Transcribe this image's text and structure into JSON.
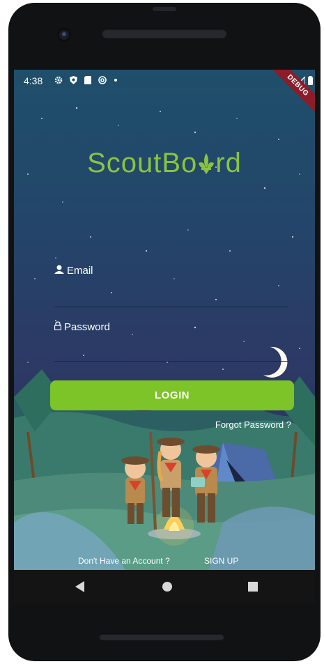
{
  "status_bar": {
    "time": "4:38",
    "left_icons": [
      "gear-icon",
      "shield-icon",
      "sd-card-icon",
      "at-sign-icon",
      "dot-icon"
    ],
    "right_icons": [
      "wifi-icon",
      "signal-icon",
      "battery-icon"
    ],
    "debug_banner": "DEBUG"
  },
  "app": {
    "logo_text_part1": "ScoutBo",
    "logo_text_part2": "rd",
    "logo_color": "#8ac43f"
  },
  "form": {
    "email_label": "Email",
    "password_label": "Password",
    "login_label": "LOGIN",
    "forgot_password": "Forgot Password ?",
    "login_button_color": "#7cc427"
  },
  "footer": {
    "no_account_text": "Don't Have an Account ?",
    "sign_up_label": "SIGN UP"
  },
  "nav_bar": {
    "buttons": [
      "back-icon",
      "home-icon",
      "recents-icon"
    ]
  }
}
